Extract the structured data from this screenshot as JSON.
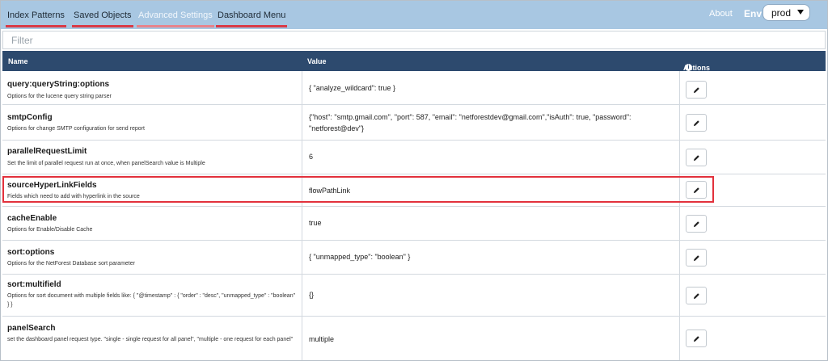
{
  "nav": {
    "tabs": [
      {
        "label": "Index Patterns"
      },
      {
        "label": "Saved Objects"
      },
      {
        "label": "Advanced Settings"
      },
      {
        "label": "Dashboard Menu"
      }
    ],
    "about_label": "About",
    "env_label": "Env",
    "env_selected": "prod"
  },
  "filter": {
    "placeholder": "Filter"
  },
  "table": {
    "headers": {
      "name": "Name",
      "value": "Value",
      "actions": "Actions"
    },
    "rows": [
      {
        "name": "query:queryString:options",
        "desc": "Options for the lucene query string parser",
        "value": "{ \"analyze_wildcard\": true }"
      },
      {
        "name": "smtpConfig",
        "desc": "Options for change SMTP configuration for send report",
        "value": "{\"host\": \"smtp.gmail.com\", \"port\": 587, \"email\": \"netforestdev@gmail.com\",\"isAuth\": true, \"password\": \"netforest@dev\"}"
      },
      {
        "name": "parallelRequestLimit",
        "desc": "Set the limit of parallel request run at once, when panelSearch value is Multiple",
        "value": "6"
      },
      {
        "name": "sourceHyperLinkFields",
        "desc": "Fields which need to add with hyperlink in the source",
        "value": "flowPathLink"
      },
      {
        "name": "cacheEnable",
        "desc": "Options for Enable/Disable Cache",
        "value": "true"
      },
      {
        "name": "sort:options",
        "desc": "Options for the NetForest Database sort parameter",
        "value": "{ \"unmapped_type\": \"boolean\" }"
      },
      {
        "name": "sort:multifield",
        "desc": "Options for sort document with multiple fields like: { \"@timestamp\" : { \"order\" : \"desc\", \"unmapped_type\" : \"boolean\" } }",
        "value": "{}"
      },
      {
        "name": "panelSearch",
        "desc": "set the dashboard panel request type. \"single - single request for all panel\", \"multiple - one request for each panel\"",
        "value": "multiple"
      }
    ]
  }
}
